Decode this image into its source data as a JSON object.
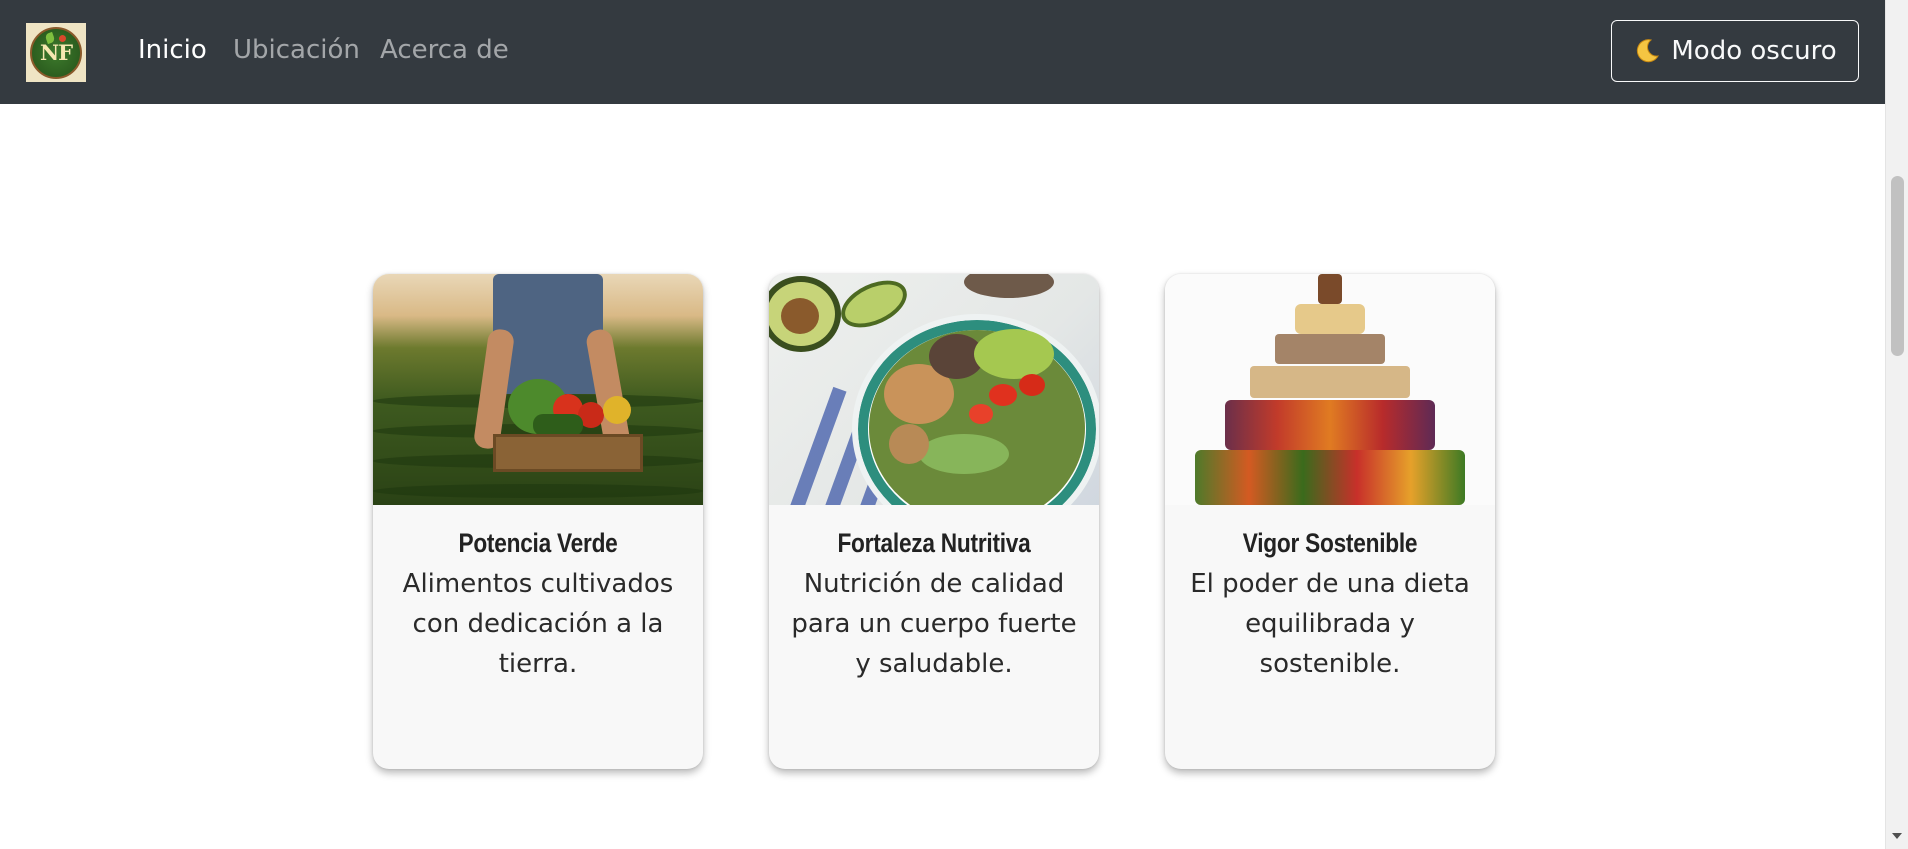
{
  "navbar": {
    "logo_text": "NF",
    "links": [
      {
        "label": "Inicio",
        "active": true
      },
      {
        "label": "Ubicación",
        "active": false
      },
      {
        "label": "Acerca de",
        "active": false
      }
    ],
    "dark_mode_button": {
      "icon": "moon-icon",
      "label": "Modo oscuro"
    }
  },
  "cards": [
    {
      "image": "farmer-holding-vegetable-crate",
      "title": "Potencia Verde",
      "text": "Alimentos cultivados con dedicación a la tierra."
    },
    {
      "image": "salad-bowl-with-avocado",
      "title": "Fortaleza Nutritiva",
      "text": "Nutrición de calidad para un cuerpo fuerte y saludable."
    },
    {
      "image": "food-pyramid",
      "title": "Vigor Sostenible",
      "text": "El poder de una dieta equilibrada y sostenible."
    }
  ],
  "colors": {
    "navbar_bg": "#343a40",
    "card_bg": "#f8f8f8",
    "page_bg": "#ffffff"
  }
}
